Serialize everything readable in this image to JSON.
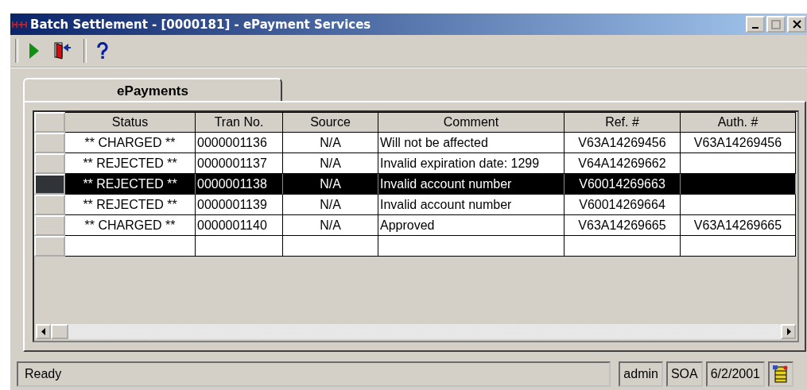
{
  "window": {
    "title": "Batch Settlement - [0000181] - ePayment Services"
  },
  "tabs": [
    {
      "label": "ePayments",
      "selected": true
    }
  ],
  "table": {
    "columns": [
      "Status",
      "Tran No.",
      "Source",
      "Comment",
      "Ref. #",
      "Auth. #"
    ],
    "rows": [
      {
        "selected": false,
        "cells": [
          "** CHARGED **",
          "0000001136",
          "N/A",
          "Will not be affected",
          "V63A14269456",
          "V63A14269456"
        ]
      },
      {
        "selected": false,
        "cells": [
          "** REJECTED **",
          "0000001137",
          "N/A",
          "Invalid expiration date: 1299",
          "V64A14269662",
          ""
        ]
      },
      {
        "selected": true,
        "cells": [
          "** REJECTED **",
          "0000001138",
          "N/A",
          "Invalid account number",
          "V60014269663",
          ""
        ]
      },
      {
        "selected": false,
        "cells": [
          "** REJECTED **",
          "0000001139",
          "N/A",
          "Invalid account number",
          "V60014269664",
          ""
        ]
      },
      {
        "selected": false,
        "cells": [
          "** CHARGED **",
          "0000001140",
          "N/A",
          "Approved",
          "V63A14269665",
          "V63A14269665"
        ]
      }
    ]
  },
  "status_bar": {
    "message": "Ready",
    "user": "admin",
    "code": "SOA",
    "date": "6/2/2001"
  }
}
